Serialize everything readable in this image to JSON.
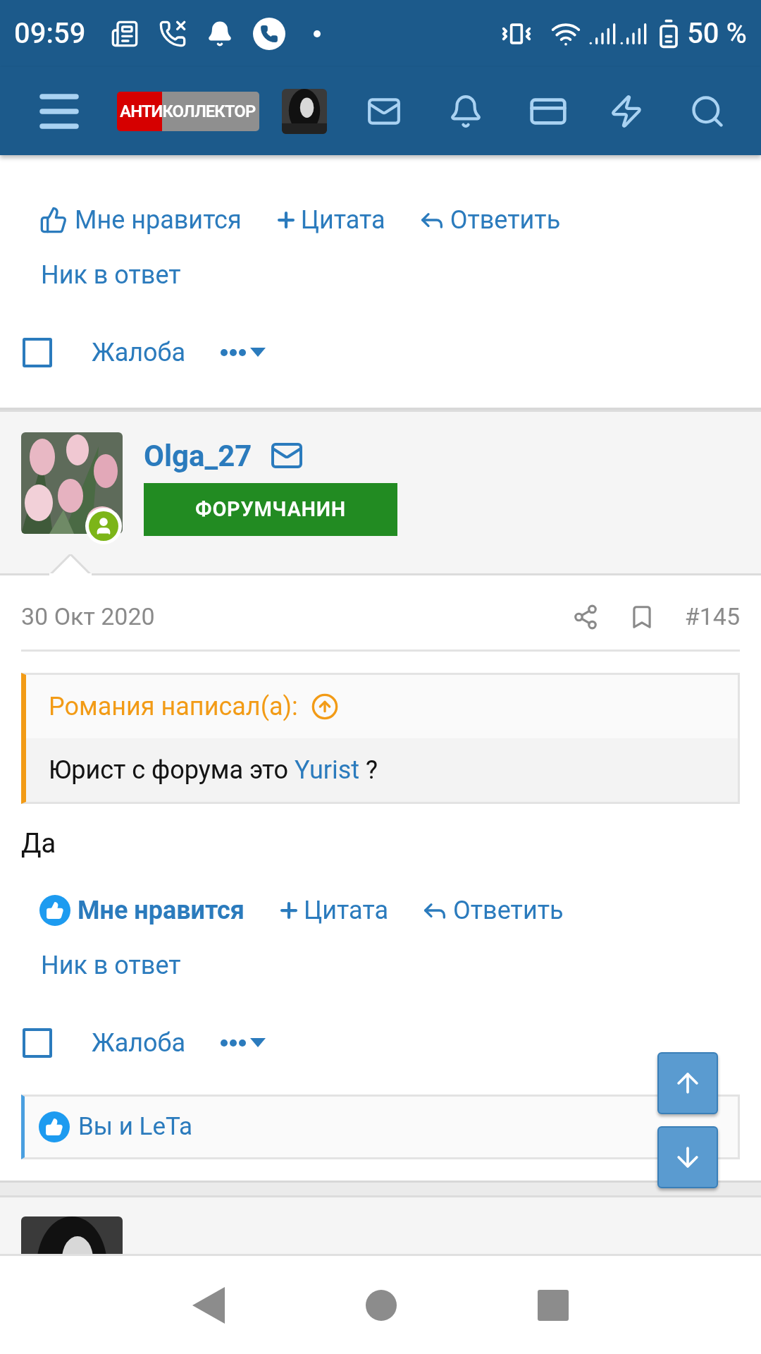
{
  "status_bar": {
    "time": "09:59",
    "battery": "50 %"
  },
  "header": {
    "logo": {
      "red_part": "АНТИ",
      "grey_part": "КОЛЛЕКТОР"
    }
  },
  "posts": [
    {
      "kind": "partial",
      "actions": {
        "like": {
          "label": "Мне нравится",
          "liked": false
        },
        "quote": "Цитата",
        "reply": "Ответить",
        "nick": "Ник в ответ",
        "report": "Жалоба",
        "checked": false
      }
    },
    {
      "kind": "full",
      "author": "Olga_27",
      "badge": "ФОРУМЧАНИН",
      "online": true,
      "date": "30 Окт 2020",
      "number": "#145",
      "quote": {
        "title": "Романия написал(а):",
        "text_before": "Юрист с форума это",
        "link": "Yurist",
        "text_after": "?"
      },
      "body": "Да",
      "actions": {
        "like": {
          "label": "Мне нравится",
          "liked": true
        },
        "quote": "Цитата",
        "reply": "Ответить",
        "nick": "Ник в ответ",
        "report": "Жалоба",
        "checked": false
      },
      "reactions": "Вы и LeTa"
    },
    {
      "kind": "cut"
    }
  ]
}
